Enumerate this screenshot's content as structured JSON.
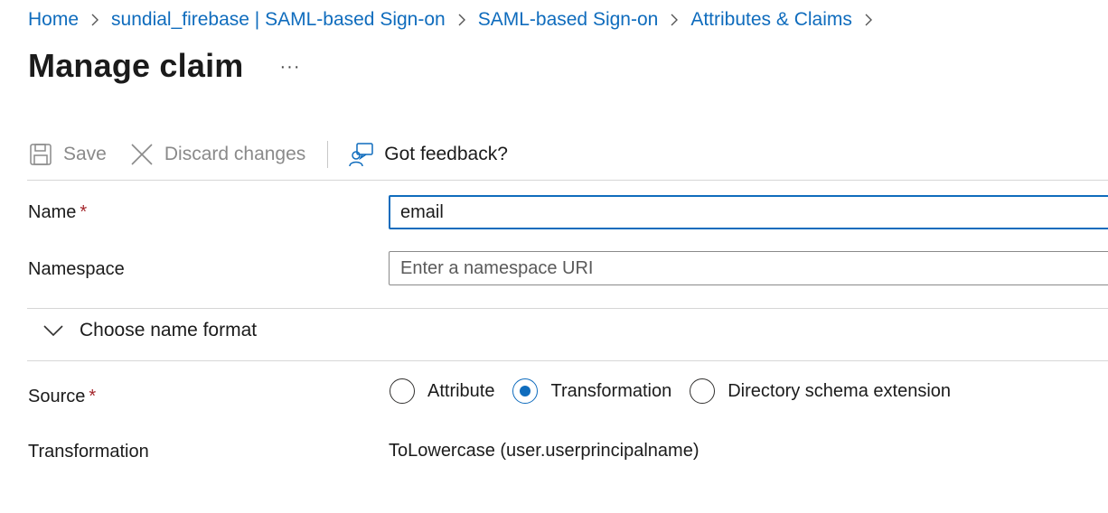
{
  "breadcrumb": {
    "items": [
      "Home",
      "sundial_firebase | SAML-based Sign-on",
      "SAML-based Sign-on",
      "Attributes & Claims"
    ]
  },
  "header": {
    "title": "Manage claim",
    "more_label": "···"
  },
  "toolbar": {
    "save_label": "Save",
    "discard_label": "Discard changes",
    "feedback_label": "Got feedback?"
  },
  "form": {
    "name": {
      "label": "Name",
      "required_mark": "*",
      "value": "email"
    },
    "namespace": {
      "label": "Namespace",
      "value": "",
      "placeholder": "Enter a namespace URI"
    },
    "name_format": {
      "label": "Choose name format",
      "expanded": false
    },
    "source": {
      "label": "Source",
      "required_mark": "*",
      "options": [
        "Attribute",
        "Transformation",
        "Directory schema extension"
      ],
      "selected": "Transformation"
    },
    "transformation": {
      "label": "Transformation",
      "value": "ToLowercase (user.userprincipalname)"
    }
  },
  "colors": {
    "accent": "#0f6cbd",
    "required": "#a4262c",
    "disabled": "#8a8a8a"
  }
}
